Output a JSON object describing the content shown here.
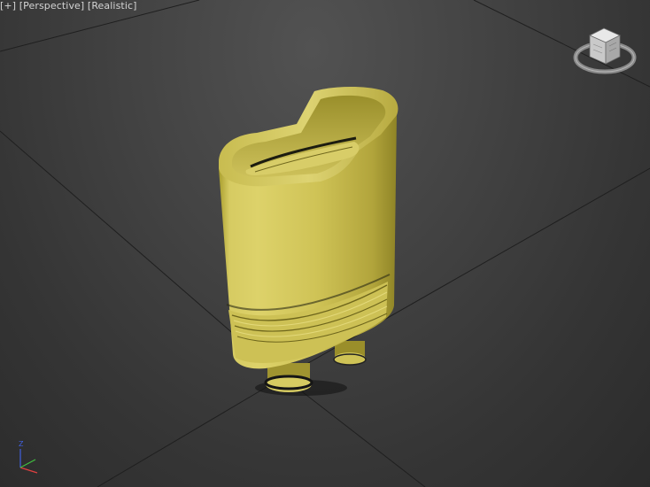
{
  "viewport": {
    "label_plus": "[+]",
    "label_view": "[Perspective]",
    "label_shading": "[Realistic]"
  },
  "viewcube": {
    "icon": "viewcube-icon",
    "compass_icon": "compass-ring-icon"
  },
  "axis": {
    "icon": "axis-tripod-icon",
    "z_label": "Z",
    "colors": {
      "x": "#e04040",
      "y": "#40c040",
      "z": "#4060e0"
    }
  },
  "scene": {
    "object_icon": "connector-plug-model",
    "colors": {
      "body": "#cfc352",
      "grid": "#1e1e1e"
    }
  }
}
